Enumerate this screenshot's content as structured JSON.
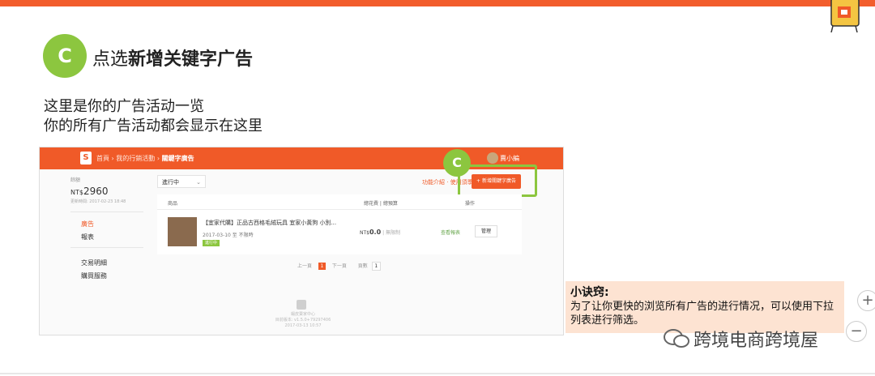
{
  "slide": {
    "badge_letter": "C",
    "heading_normal": "点选",
    "heading_bold": "新增关键字广告",
    "desc_line1": "这里是你的广告活动一览",
    "desc_line2": "你的所有广告活动都会显示在这里"
  },
  "shot": {
    "breadcrumb_1": "首頁",
    "breadcrumb_sep": "›",
    "breadcrumb_2": "我的行銷活動",
    "breadcrumb_3": "關鍵字廣告",
    "username": "賣小編",
    "balance_label": "餘額",
    "balance_currency": "NT$",
    "balance_value": "2960",
    "updated": "更新時間: 2017-02-23 18:48",
    "side_ads": "廣告",
    "side_report": "報表",
    "side_transactions": "交易明細",
    "side_buy": "購買服務",
    "filter_value": "進行中",
    "func_intro": "功能介紹 · 使用須季",
    "add_button": "+ 新增關鍵字廣告",
    "highlight_badge": "C",
    "col_product": "商品",
    "col_spend": "總花費 | 總預算",
    "col_action": "操作",
    "product_name": "【宜家代購】正品古西格毛絨玩具 宜家小黃狗 小別...",
    "product_date": "2017-03-10 至 不限時",
    "product_status": "進行中",
    "spend_currency": "NT$",
    "spend_value": "0.0",
    "spend_budget": "| 無限制",
    "view_report": "查看報表",
    "manage_button": "管理",
    "pager_prev": "上一頁",
    "pager_current": "1",
    "pager_next": "下一頁",
    "pager_goto": "頁數",
    "pager_box": "1",
    "footer_1": "蝦皮賣家中心",
    "footer_2": "目前版本: v1.5.0+79297406",
    "footer_3": "2017-03-13 10:57"
  },
  "tip": {
    "title": "小诀窍:",
    "body": "为了让你更快的浏览所有广告的进行情况，可以使用下拉列表进行筛选。"
  },
  "watermark": "跨境电商跨境屋",
  "zoom": {
    "plus": "+",
    "minus": "−"
  },
  "colors": {
    "brand_orange": "#f05a28",
    "accent_green": "#8cc63f",
    "tip_bg": "#fde3d2"
  }
}
